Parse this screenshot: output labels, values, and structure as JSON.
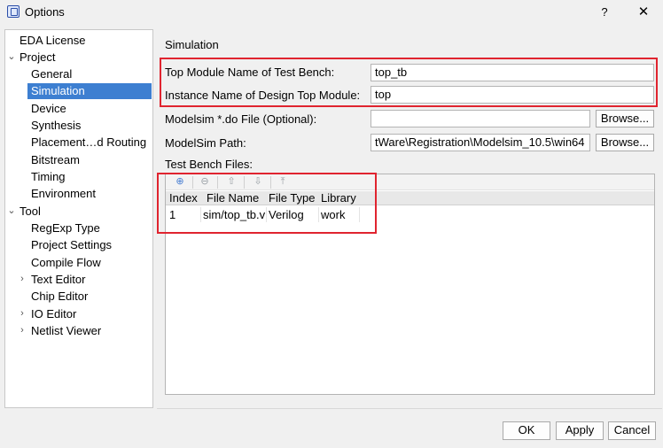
{
  "window": {
    "title": "Options",
    "help_label": "?",
    "close_label": "✕"
  },
  "tree": {
    "items": [
      {
        "label": "EDA License",
        "selected": false
      },
      {
        "label": "Project",
        "expanded": true
      },
      {
        "label": "General"
      },
      {
        "label": "Simulation",
        "selected": true
      },
      {
        "label": "Device"
      },
      {
        "label": "Synthesis"
      },
      {
        "label": "Placement…d Routing"
      },
      {
        "label": "Bitstream"
      },
      {
        "label": "Timing"
      },
      {
        "label": "Environment"
      },
      {
        "label": "Tool",
        "expanded": true
      },
      {
        "label": "RegExp Type"
      },
      {
        "label": "Project Settings"
      },
      {
        "label": "Compile Flow"
      },
      {
        "label": "Text Editor",
        "expandable": true
      },
      {
        "label": "Chip Editor"
      },
      {
        "label": "IO Editor",
        "expandable": true
      },
      {
        "label": "Netlist Viewer",
        "expandable": true
      }
    ]
  },
  "simulation": {
    "section_title": "Simulation",
    "top_module_label": "Top Module Name of Test Bench:",
    "top_module_value": "top_tb",
    "instance_label": "Instance Name of Design Top Module:",
    "instance_value": "top",
    "do_file_label": "Modelsim *.do File (Optional):",
    "do_file_value": "",
    "modelsim_path_label": "ModelSim Path:",
    "modelsim_path_value": "tWare\\Registration\\Modelsim_10.5\\win64",
    "browse_label": "Browse...",
    "test_bench_label": "Test Bench Files:"
  },
  "test_bench_table": {
    "toolbar": [
      "add-icon",
      "remove-icon",
      "move-up-icon",
      "move-down-icon",
      "move-top-icon"
    ],
    "columns": [
      "Index",
      "File Name",
      "File Type",
      "Library"
    ],
    "rows": [
      [
        "1",
        "sim/top_tb.v",
        "Verilog",
        "work"
      ]
    ]
  },
  "footer": {
    "ok_label": "OK",
    "apply_label": "Apply",
    "cancel_label": "Cancel"
  },
  "colors": {
    "highlight": "#e0242f",
    "selection": "#3d7fd1"
  }
}
